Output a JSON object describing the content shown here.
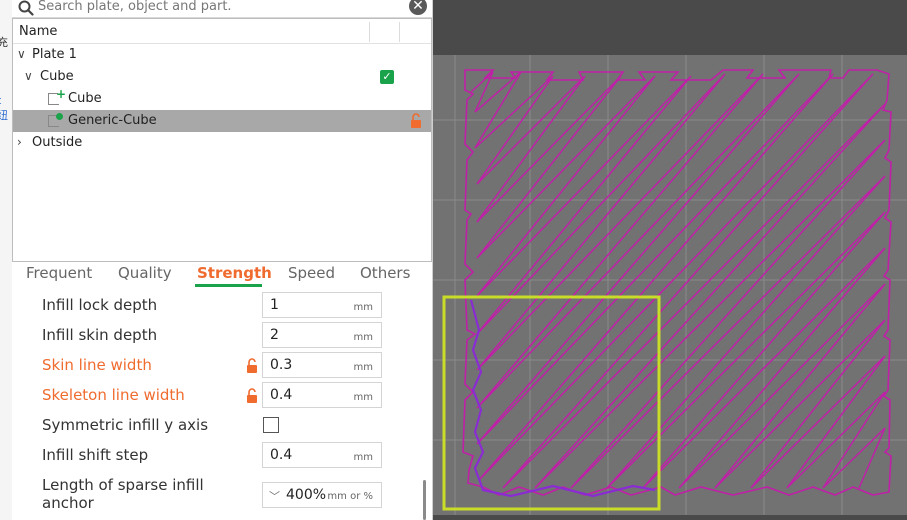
{
  "search": {
    "placeholder": "Search plate, object and part.",
    "clear_glyph": "✕"
  },
  "tree": {
    "header": {
      "name_label": "Name"
    },
    "rows": [
      {
        "label": "Plate 1",
        "expanded": true
      },
      {
        "label": "Cube",
        "expanded": true,
        "visible_checked": true
      },
      {
        "label": "Cube",
        "icon": "add-part-icon"
      },
      {
        "label": "Generic-Cube",
        "icon": "modifier-part-icon",
        "selected": true,
        "locked_icon": "unlocked-lock-icon"
      },
      {
        "label": "Outside",
        "expanded": false
      }
    ]
  },
  "tabs": [
    {
      "label": "Frequent",
      "active": false
    },
    {
      "label": "Quality",
      "active": false
    },
    {
      "label": "Strength",
      "active": true
    },
    {
      "label": "Speed",
      "active": false
    },
    {
      "label": "Others",
      "active": false
    }
  ],
  "settings": [
    {
      "label": "Infill lock depth",
      "value": "1",
      "unit": "mm",
      "modified": false
    },
    {
      "label": "Infill skin depth",
      "value": "2",
      "unit": "mm",
      "modified": false
    },
    {
      "label": "Skin line width",
      "value": "0.3",
      "unit": "mm",
      "modified": true
    },
    {
      "label": "Skeleton line width",
      "value": "0.4",
      "unit": "mm",
      "modified": true
    },
    {
      "label": "Symmetric infill y axis",
      "type": "checkbox",
      "checked": false
    },
    {
      "label": "Infill shift step",
      "value": "0.4",
      "unit": "mm",
      "modified": false
    },
    {
      "label": "Length of sparse infill anchor",
      "value": "400%",
      "unit": "mm or %",
      "type": "combo",
      "modified": false
    }
  ],
  "colors": {
    "accent_orange": "#ef6b2e",
    "accent_green": "#1aa34a",
    "toolpath_magenta": "#c020a8",
    "selection_box": "#c8dc28",
    "viewport_bg": "#4a4a4a",
    "plate_gray": "#727272"
  }
}
